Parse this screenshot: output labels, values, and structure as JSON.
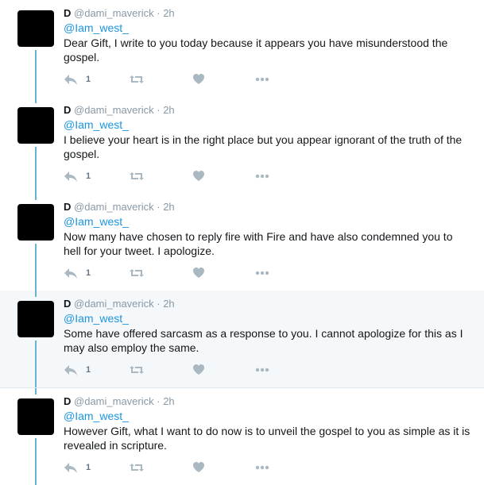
{
  "tweets": [
    {
      "name": "D",
      "handle": "@dami_maverick",
      "time": "· 2h",
      "mention": "@Iam_west_",
      "text": "Dear Gift, I write to you today because it appears you have misunderstood the gospel.",
      "reply_count": "1",
      "highlighted": false
    },
    {
      "name": "D",
      "handle": "@dami_maverick",
      "time": "· 2h",
      "mention": "@Iam_west_",
      "text": "I believe your heart is in the right place but you appear ignorant of the truth of the gospel.",
      "reply_count": "1",
      "highlighted": false
    },
    {
      "name": "D",
      "handle": "@dami_maverick",
      "time": "· 2h",
      "mention": "@Iam_west_",
      "text": "Now many have chosen to reply fire with Fire and have also condemned you to hell for your tweet. I apologize.",
      "reply_count": "1",
      "highlighted": false
    },
    {
      "name": "D",
      "handle": "@dami_maverick",
      "time": "· 2h",
      "mention": "@Iam_west_",
      "text": "Some have offered sarcasm as a response to you. I cannot apologize for this as I may also employ the same.",
      "reply_count": "1",
      "highlighted": true
    },
    {
      "name": "D",
      "handle": "@dami_maverick",
      "time": "· 2h",
      "mention": "@Iam_west_",
      "text": "However Gift, what I want to do now is to unveil the gospel to you as simple as it is revealed in scripture.",
      "reply_count": "1",
      "highlighted": false
    }
  ],
  "icons": {
    "reply": "reply-icon",
    "retweet": "retweet-icon",
    "like": "heart-icon",
    "more": "more-icon"
  },
  "colors": {
    "thread_line": "#68b2d6",
    "mention": "#1b95e0",
    "icon": "#aab8c2",
    "highlight_bg": "#f5f8fa"
  }
}
